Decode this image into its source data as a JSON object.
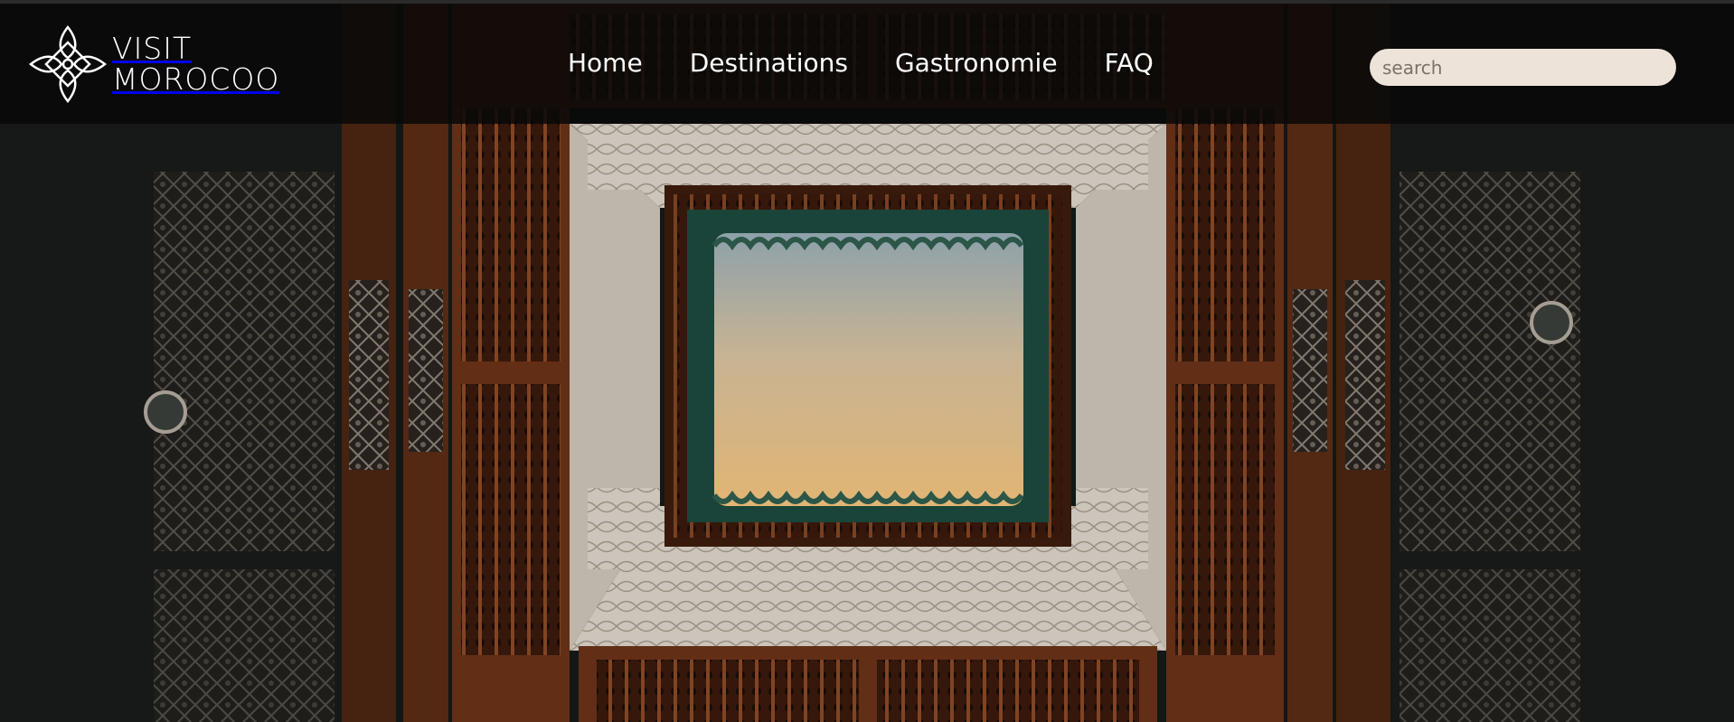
{
  "header": {
    "logo": {
      "line1": "VISIT",
      "line2": "MOROCOO",
      "icon": "ornamental-flower-icon"
    },
    "nav": [
      {
        "label": "Home"
      },
      {
        "label": "Destinations"
      },
      {
        "label": "Gastronomie"
      },
      {
        "label": "FAQ"
      }
    ],
    "search": {
      "placeholder": "search",
      "value": ""
    }
  },
  "hero": {
    "image": "moroccan-riad-courtyard-ceiling-photo"
  },
  "colors": {
    "header_bg": "#080808",
    "search_bg": "#ede3d9",
    "wood": "#6b2f14",
    "sky_top": "#9fb3bb",
    "sky_bottom": "#f3c27c",
    "plaster": "#e9e4dc"
  }
}
